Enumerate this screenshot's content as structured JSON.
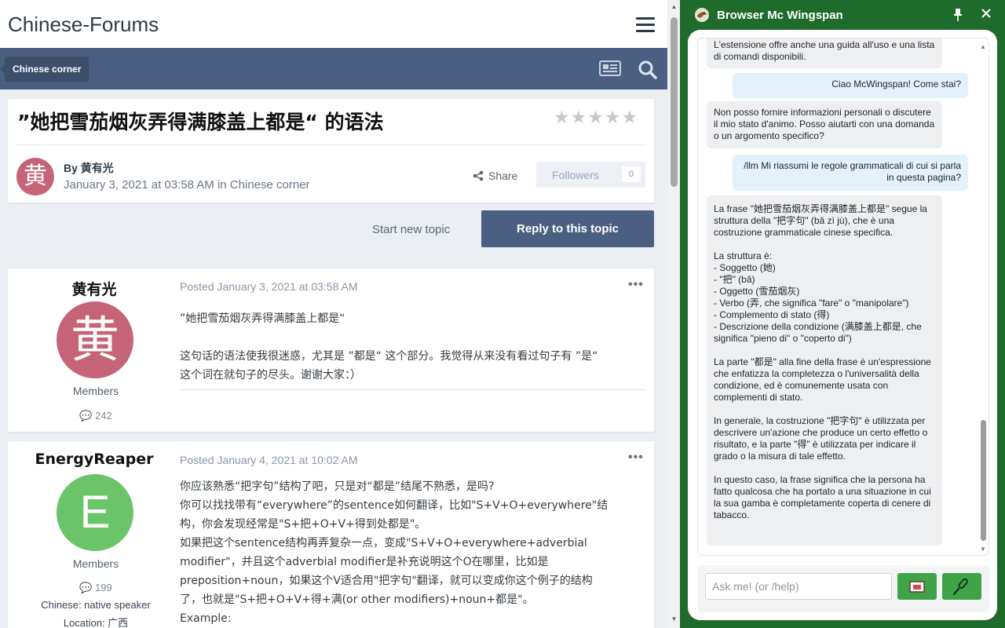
{
  "forum": {
    "site_title": "Chinese-Forums",
    "breadcrumb": "Chinese corner",
    "topic": {
      "title": "”她把雪茄烟灰弄得满膝盖上都是“ 的语法",
      "stars": "★★★★★",
      "avatar_char": "黄",
      "by": "By 黄有光",
      "date": "January 3, 2021 at 03:58 AM in Chinese corner",
      "share": "Share",
      "followers_label": "Followers",
      "followers_count": "0"
    },
    "start_topic": "Start new topic",
    "reply_button": "Reply to this topic",
    "posts": [
      {
        "author": "黄有光",
        "avatar_char": "黄",
        "avatar_color": "#c56478",
        "role": "Members",
        "count": "242",
        "posted": "Posted January 3, 2021 at 03:58 AM",
        "lines": [
          "”她把雪茄烟灰弄得满膝盖上都是“",
          "",
          "这句话的语法使我很迷惑，尤其是 ”都是“ 这个部分。我觉得从来没有看过句子有 ”是“",
          "这个词在就句子的尽头。谢谢大家：）"
        ]
      },
      {
        "author": "EnergyReaper",
        "avatar_char": "E",
        "avatar_color": "#6cc46a",
        "role": "Members",
        "count": "199",
        "extra1": "Chinese: native speaker",
        "extra2": "Location: 广西",
        "posted": "Posted January 4, 2021 at 10:02 AM",
        "lines": [
          "你应该熟悉“把字句”结构了吧，只是对“都是”结尾不熟悉，是吗?",
          "你可以找找带有“everywhere”的sentence如何翻译，比如\"S+V+O+everywhere\"结",
          "构，你会发现经常是\"S+把+O+V+得到处都是\"。",
          "如果把这个sentence结构再弄复杂一点，变成\"S+V+O+everywhere+adverbial",
          "modifier\"，并且这个adverbial modifier是补充说明这个O在哪里，比如是",
          "preposition+noun，如果这个V适合用\"把字句\"翻译，就可以变成你这个例子的结构",
          "了，也就是\"S+把+O+V+得+满(or other modifiers)+noun+都是\"。",
          "Example:"
        ]
      }
    ]
  },
  "panel": {
    "title": "Browser Mc Wingspan",
    "input_placeholder": "Ask me! (or /help)",
    "messages": [
      {
        "role": "bot",
        "text": "L'estensione offre anche una guida all'uso e una lista di comandi disponibili."
      },
      {
        "role": "user",
        "text": "Ciao McWingspan! Come stai?"
      },
      {
        "role": "bot",
        "text": "Non posso fornire informazioni personali o discutere il mio stato d'animo. Posso aiutarti con una domanda o un argomento specifico?"
      },
      {
        "role": "user",
        "text": "/llm Mi riassumi le regole grammaticali di cui si parla in questa pagina?"
      },
      {
        "role": "bot",
        "lines": [
          "La frase \"她把雪茄烟灰弄得满膝盖上都是\" segue la struttura della \"把字句\" (bǎ zì jù), che è una costruzione grammaticale cinese specifica.",
          "",
          "La struttura è:",
          "- Soggetto (她)",
          "- \"把\" (bǎ)",
          "- Oggetto (雪茄烟灰)",
          "- Verbo (弄, che significa \"fare\" o \"manipolare\")",
          "- Complemento di stato (得)",
          "- Descrizione della condizione (满膝盖上都是, che significa \"pieno di\" o \"coperto di\")",
          "",
          "La parte \"都是\" alla fine della frase è un'espressione che enfatizza la completezza o l'universalità della condizione, ed è comunemente usata con complementi di stato.",
          "",
          "In generale, la costruzione \"把字句\" è utilizzata per descrivere un'azione che produce un certo effetto o risultato, e la parte \"得\" è utilizzata per indicare il grado o la misura di tale effetto.",
          "",
          "In questo caso, la frase significa che la persona ha fatto qualcosa che ha portato a una situazione in cui la sua gamba è completamente coperta di cenere di tabacco."
        ]
      }
    ]
  }
}
